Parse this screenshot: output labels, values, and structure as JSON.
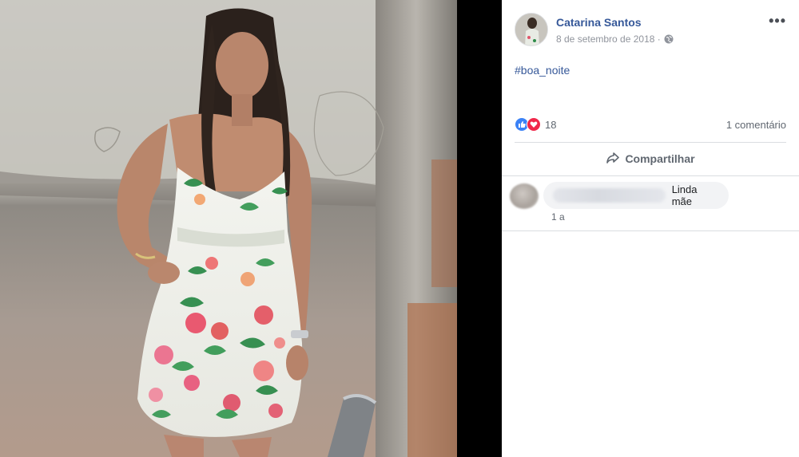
{
  "post": {
    "author": "Catarina Santos",
    "date": "8 de setembro de 2018 ·",
    "privacy_icon": "globe-icon",
    "text": "#boa_noite",
    "more_icon": "more-options-icon"
  },
  "reactions": {
    "icons": [
      "like-icon",
      "love-icon"
    ],
    "count": "18",
    "comments_count": "1 comentário"
  },
  "actions": {
    "share_label": "Compartilhar",
    "share_icon": "share-arrow-icon"
  },
  "comments": [
    {
      "text": "Linda mãe",
      "time": "1 a"
    }
  ],
  "colors": {
    "link": "#365899",
    "like": "#3b82f6",
    "love": "#f0284a",
    "bubble": "#f2f3f5"
  }
}
